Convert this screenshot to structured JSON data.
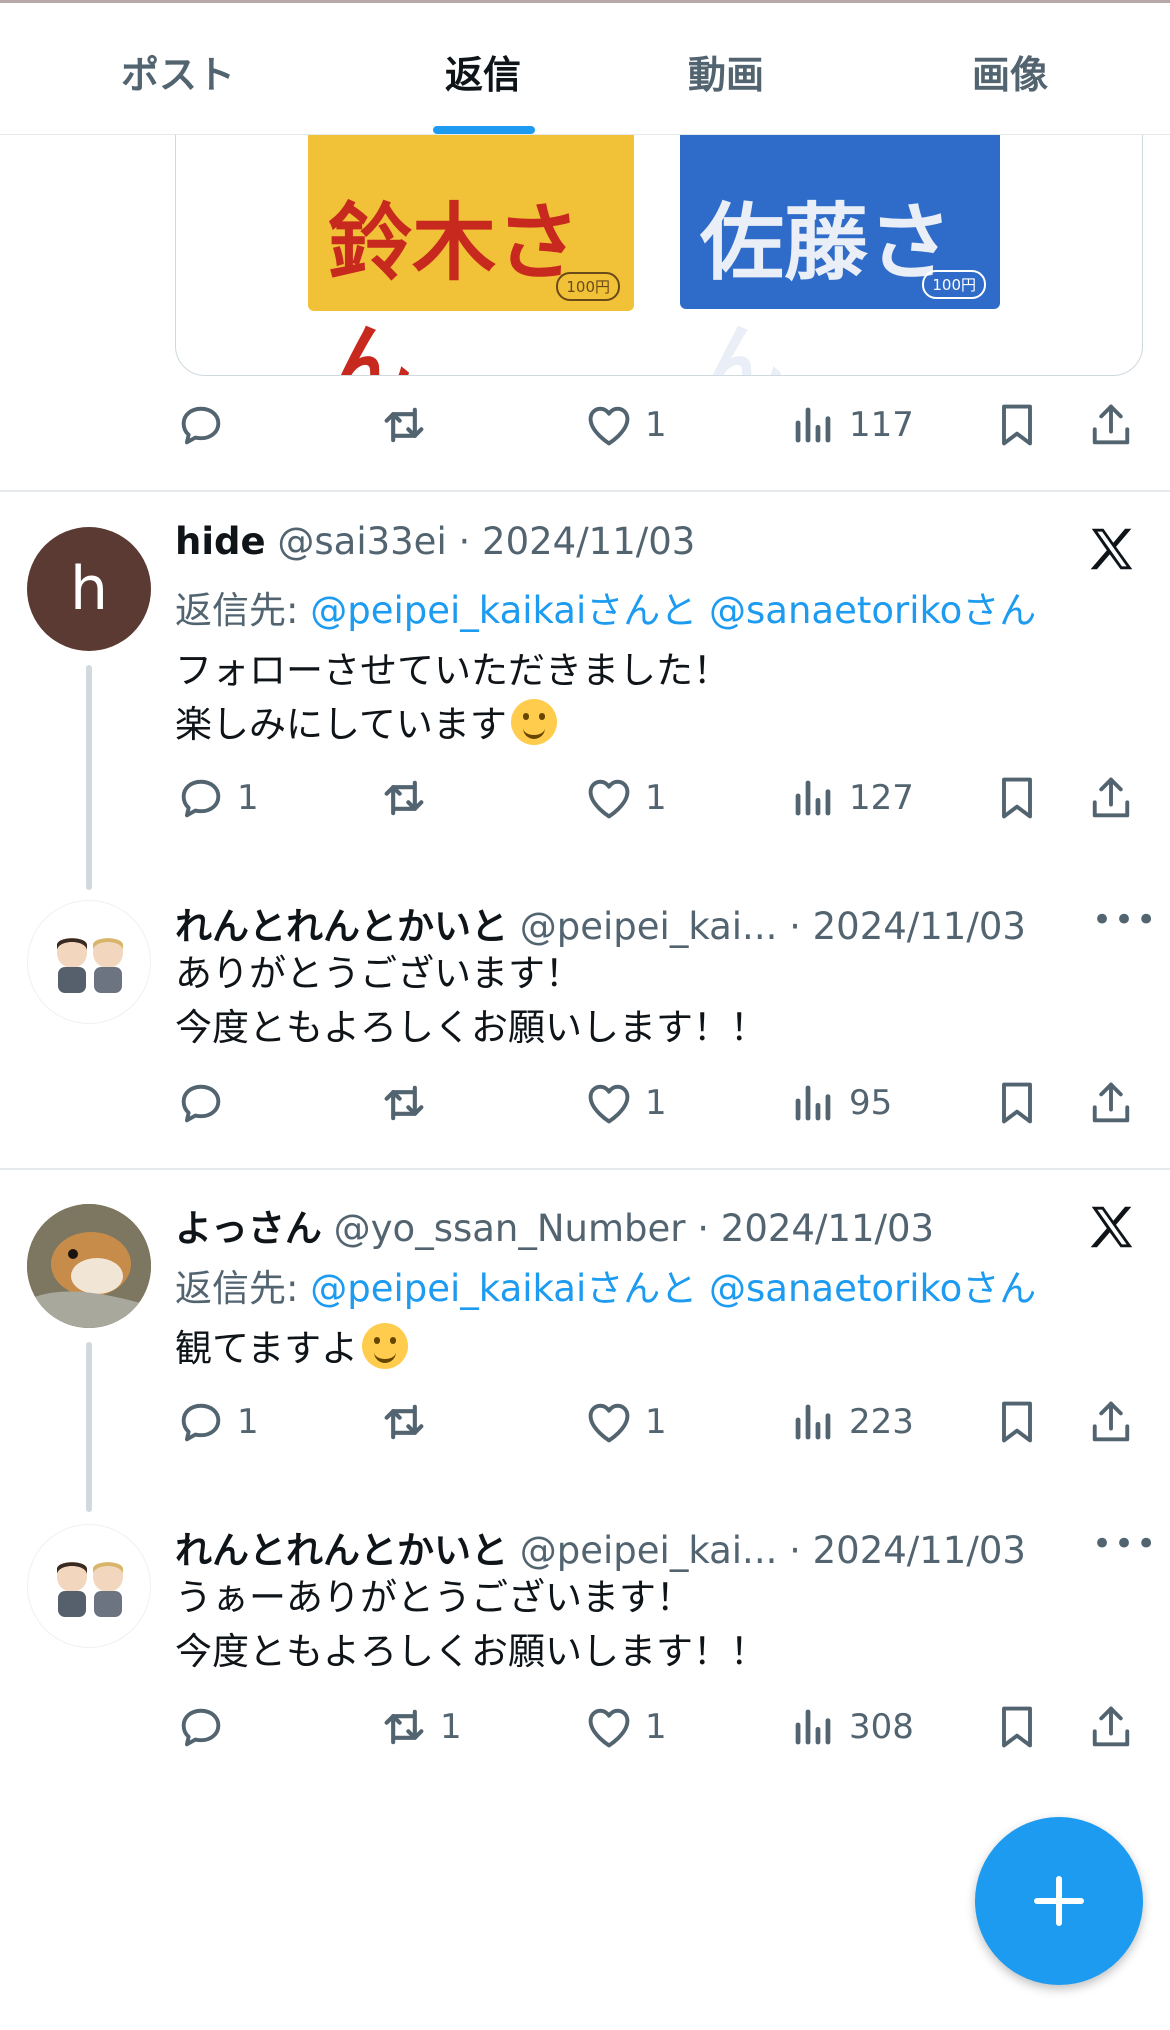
{
  "tabs": [
    {
      "label": "ポスト",
      "active": false
    },
    {
      "label": "返信",
      "active": true
    },
    {
      "label": "動画",
      "active": false
    },
    {
      "label": "画像",
      "active": false
    }
  ],
  "quote_image": {
    "left_text": "鈴木さん",
    "left_price": "100円",
    "right_text": "佐藤さん",
    "right_price": "100円"
  },
  "top_actions": {
    "replies": "",
    "reposts": "",
    "likes": "1",
    "views": "117"
  },
  "posts": [
    {
      "name": "hide",
      "handle": "@sai33ei",
      "dot": "·",
      "date": "2024/11/03",
      "avatar_letter": "h",
      "reply_prefix": "返信先:",
      "mention1": "@peipei_kaikai",
      "joiner": "さんと",
      "mention2": "@sanaetoriko",
      "suffix": "さん",
      "line1": "フォローさせていただきました！",
      "line2": "楽しみにしています",
      "emoji": "smiling-face",
      "replies": "1",
      "reposts": "",
      "likes": "1",
      "views": "127"
    },
    {
      "name": "れんとれんとかいと",
      "handle": "@peipei_kai...",
      "dot": "·",
      "date": "2024/11/03",
      "more": "•••",
      "line1": "ありがとうございます！",
      "line2": "今度ともよろしくお願いします！！",
      "replies": "",
      "reposts": "",
      "likes": "1",
      "views": "95"
    },
    {
      "name": "よっさん",
      "handle": "@yo_ssan_Number",
      "dot": "·",
      "date": "2024/11/03",
      "reply_prefix": "返信先:",
      "mention1": "@peipei_kaikai",
      "joiner": "さんと",
      "mention2": "@sanaetoriko",
      "suffix": "さん",
      "line1": "観てますよ",
      "emoji": "grinning-face",
      "replies": "1",
      "reposts": "",
      "likes": "1",
      "views": "223"
    },
    {
      "name": "れんとれんとかいと",
      "handle": "@peipei_kai...",
      "dot": "·",
      "date": "2024/11/03",
      "more": "•••",
      "line1": "うぁーありがとうございます！",
      "line2": "今度ともよろしくお願いします！！",
      "replies": "",
      "reposts": "1",
      "likes": "1",
      "views": "308"
    }
  ],
  "colors": {
    "accent": "#1d9bf0",
    "secondary_text": "#536471",
    "divider": "#e6e9ec"
  }
}
